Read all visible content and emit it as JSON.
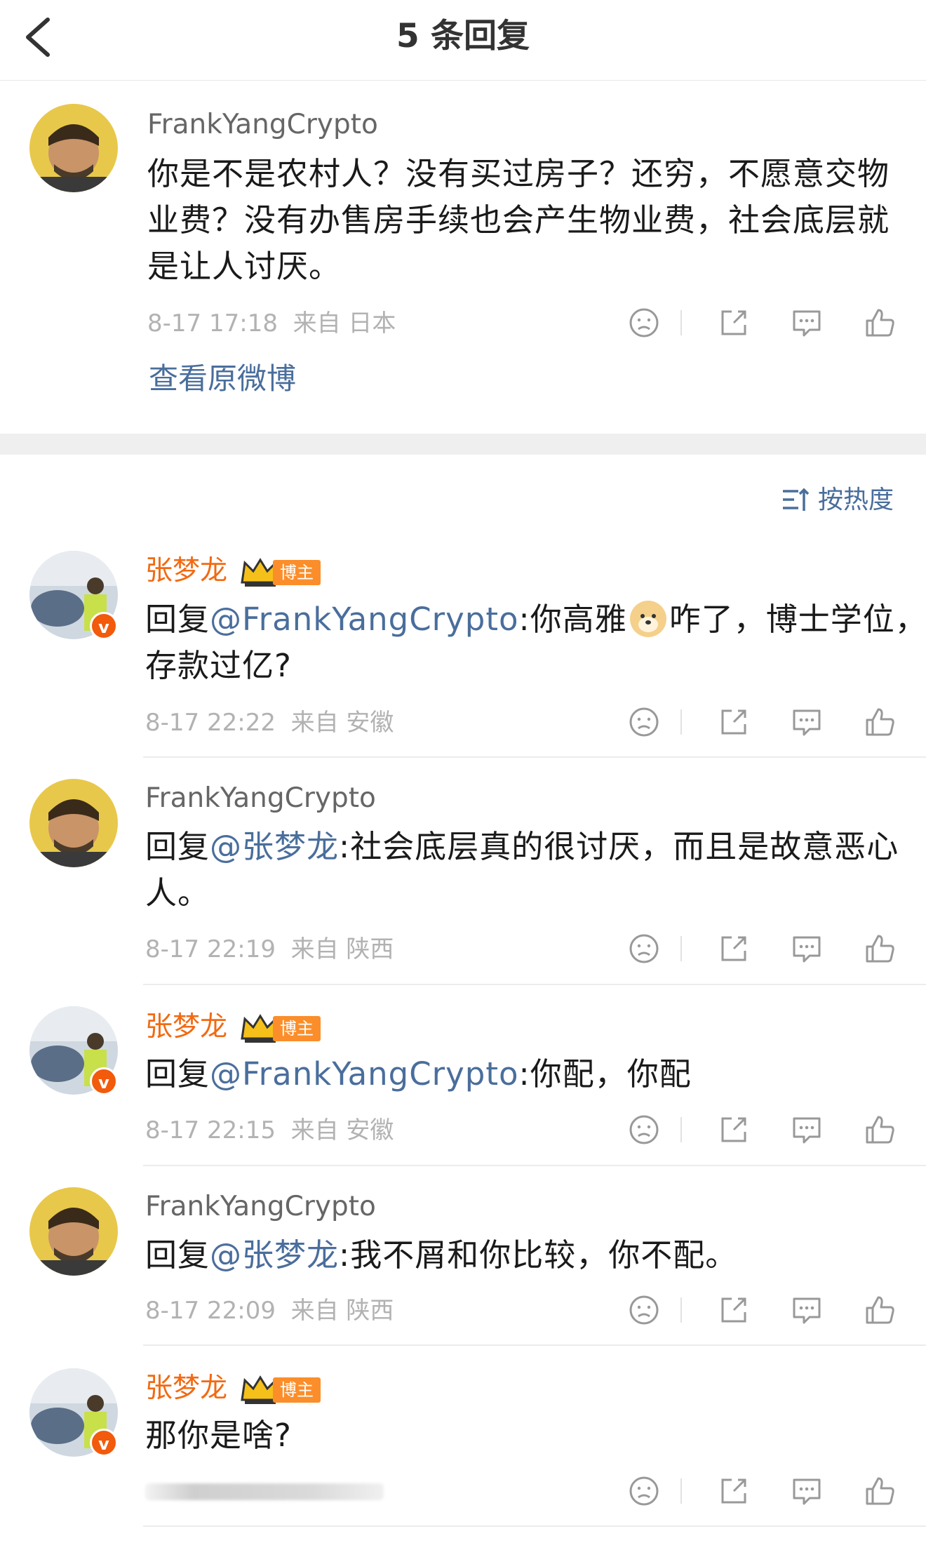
{
  "header": {
    "title": "5 条回复"
  },
  "original": {
    "author": "FrankYangCrypto",
    "text_lines": [
      "你是不是农村人？没有买过房子？还穷，不愿意交物",
      "业费？没有办售房手续也会产生物业费，社会底层就",
      "是让人讨厌。"
    ],
    "time": "8-17 17:18",
    "source": "来自 日本",
    "view_original": "查看原微博"
  },
  "sort": {
    "label": "按热度"
  },
  "blogger_tag": "博主",
  "reply_prefix": "回复",
  "replies": [
    {
      "author": "张梦龙",
      "mention": "@FrankYangCrypto",
      "line1_a": ":你高雅",
      "line1_b": "咋了，博士学位，",
      "line2": "存款过亿?",
      "time": "8-17 22:22",
      "source": "来自 安徽"
    },
    {
      "author": "FrankYangCrypto",
      "mention": "@张梦龙",
      "line1": ":社会底层真的很讨厌，而且是故意恶心",
      "line2": "人。",
      "time": "8-17 22:19",
      "source": "来自 陕西"
    },
    {
      "author": "张梦龙",
      "mention": "@FrankYangCrypto",
      "line1": ":你配，你配",
      "time": "8-17 22:15",
      "source": "来自 安徽"
    },
    {
      "author": "FrankYangCrypto",
      "mention": "@张梦龙",
      "line1": ":我不屑和你比较，你不配。",
      "time": "8-17 22:09",
      "source": "来自 陕西"
    },
    {
      "author": "张梦龙",
      "text": "那你是啥?"
    }
  ],
  "icons": [
    "back-icon",
    "dislike-icon",
    "share-icon",
    "comment-icon",
    "like-icon",
    "sort-icon",
    "crown-icon",
    "doge-emoji-icon",
    "verified-badge-icon"
  ],
  "colors": {
    "mention": "#4a6e9c",
    "blogger_name": "#f26a12",
    "tag": "#fb8e2a",
    "badge": "#f25a0c"
  }
}
